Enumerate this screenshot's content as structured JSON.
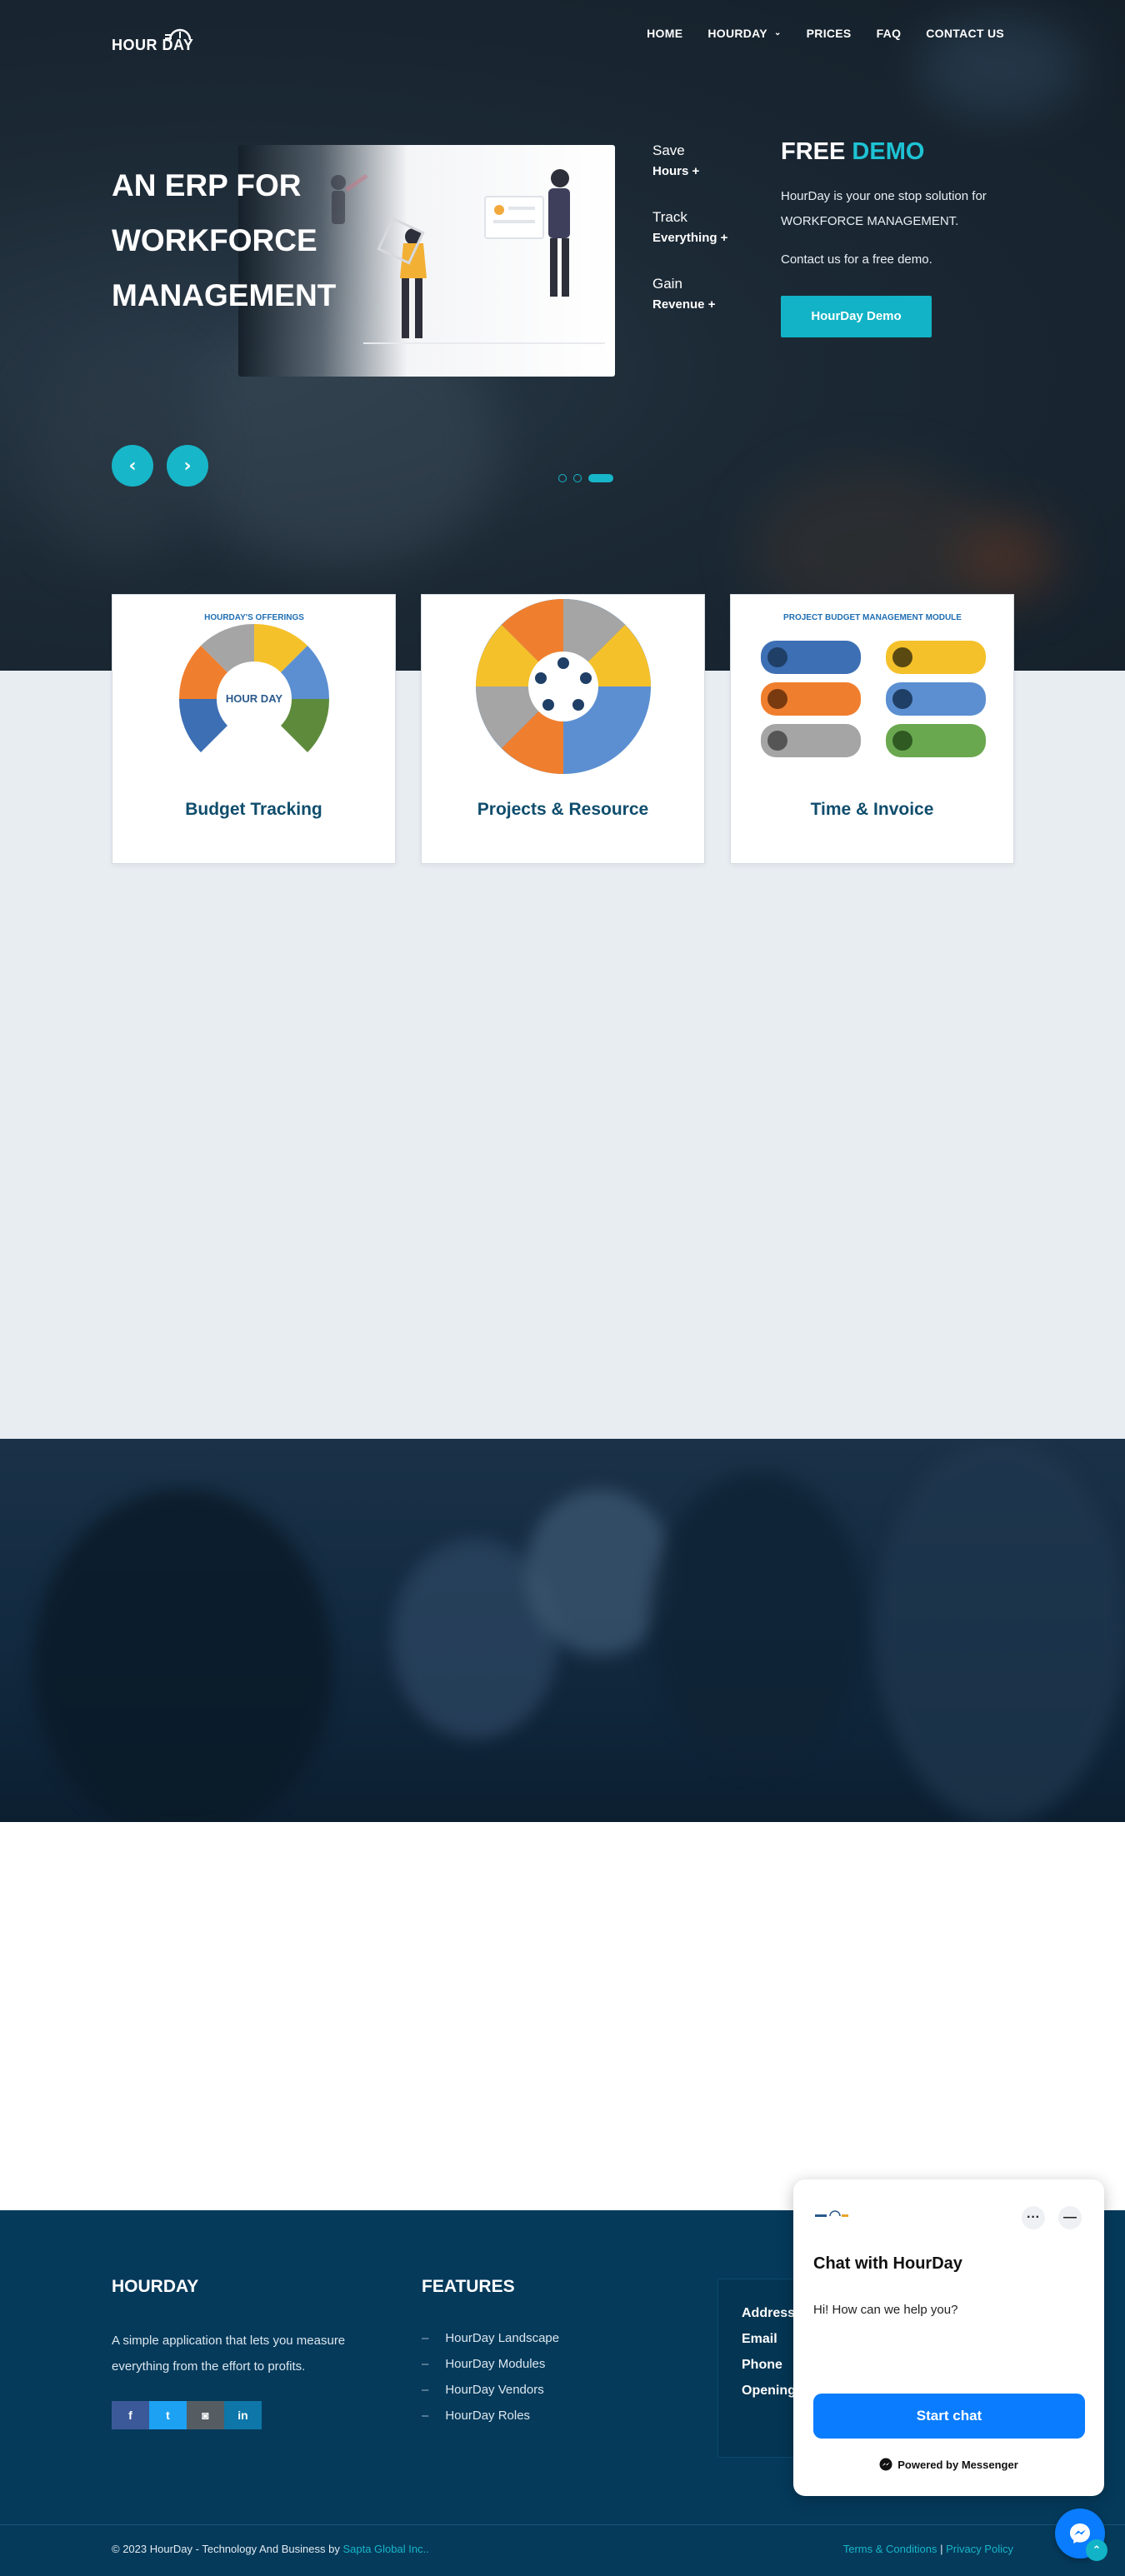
{
  "nav": {
    "logo_text": "HOUR DAY",
    "items": [
      {
        "label": "HOME"
      },
      {
        "label": "HOURDAY"
      },
      {
        "label": "PRICES"
      },
      {
        "label": "FAQ"
      },
      {
        "label": "CONTACT US"
      }
    ]
  },
  "hero": {
    "title": "AN ERP FOR WORKFORCE MANAGEMENT",
    "list": [
      {
        "top": "Save",
        "bottom": "Hours +"
      },
      {
        "top": "Track",
        "bottom": "Everything +"
      },
      {
        "top": "Gain",
        "bottom": "Revenue +"
      }
    ],
    "demo": {
      "heading_white": "FREE",
      "heading_accent": "DEMO",
      "text1": "HourDay is your one stop solution for WORKFORCE MANAGEMENT.",
      "text2": "Contact us for a free demo.",
      "button": "HourDay Demo"
    },
    "slider": {
      "prev_icon": "chevron-left-icon",
      "next_icon": "chevron-right-icon",
      "active_index": 2,
      "count": 3
    }
  },
  "cards": [
    {
      "title": "Budget Tracking",
      "fig_title": "HOURDAY'S OFFERINGS"
    },
    {
      "title": "Projects & Resource",
      "fig_title": ""
    },
    {
      "title": "Time & Invoice",
      "fig_title": "PROJECT BUDGET MANAGEMENT MODULE"
    }
  ],
  "footer": {
    "about_title": "HOURDAY",
    "about_text": "A simple application that lets you measure everything from the effort to profits.",
    "socials": [
      {
        "icon": "facebook-icon",
        "glyph": "f",
        "color": "#3b5998"
      },
      {
        "icon": "twitter-icon",
        "glyph": "t",
        "color": "#1da1f2"
      },
      {
        "icon": "instagram-icon",
        "glyph": "◙",
        "color": "#555d63"
      },
      {
        "icon": "linkedin-icon",
        "glyph": "in",
        "color": "#0e76a8"
      }
    ],
    "features_title": "FEATURES",
    "features": [
      "HourDay Landscape",
      "HourDay Modules",
      "HourDay Vendors",
      "HourDay Roles"
    ],
    "contact": [
      "Address",
      "Email",
      "Phone",
      "Opening"
    ],
    "copyright_prefix": "© 2023 HourDay - Technology And Business by",
    "copyright_link": "Sapta Global Inc..",
    "terms": "Terms & Conditions",
    "separator": "|",
    "privacy": "Privacy Policy"
  },
  "chat": {
    "title": "Chat with HourDay",
    "subtitle": "Hi! How can we help you?",
    "start_button": "Start chat",
    "powered": "Powered by Messenger",
    "more_icon": "···",
    "minimize_icon": "—"
  },
  "colors": {
    "accent": "#17b6c8",
    "footer_bg": "#053a5b",
    "messenger_blue": "#0a7cff",
    "card_title": "#0f4d6d"
  }
}
